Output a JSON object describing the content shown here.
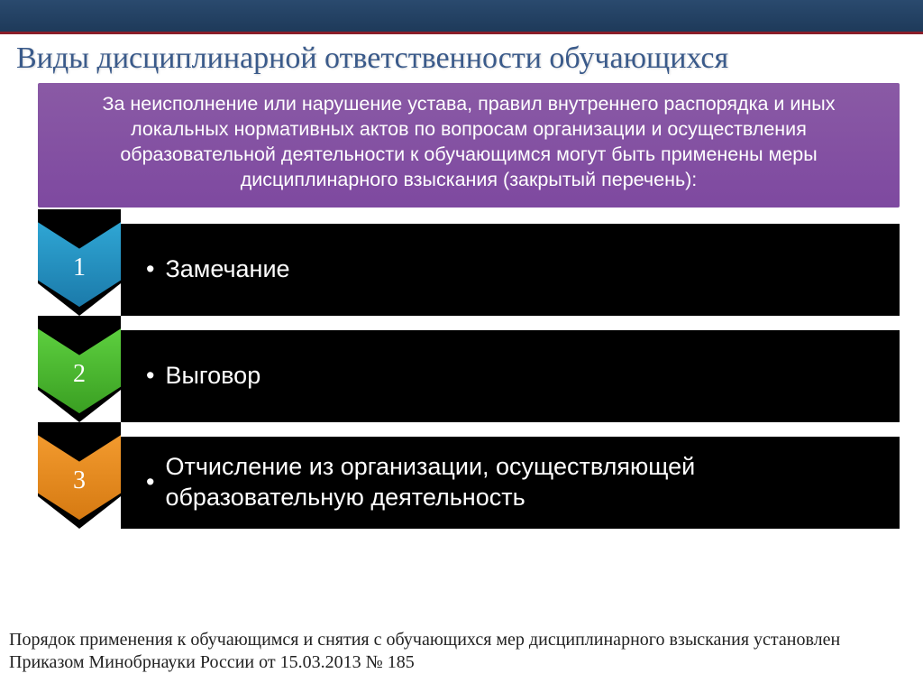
{
  "title": "Виды дисциплинарной ответственности обучающихся",
  "intro": "За неисполнение или нарушение устава, правил внутреннего распорядка и иных локальных нормативных актов по вопросам организации и осуществления образовательной деятельности к обучающимся могут быть применены меры дисциплинарного взыскания  (закрытый перечень):",
  "items": [
    {
      "num": "1",
      "text": "Замечание",
      "colorTop": "#2fa6d4",
      "colorBot": "#1b7aaa"
    },
    {
      "num": "2",
      "text": "Выговор",
      "colorTop": "#5dcf3f",
      "colorBot": "#3a9f22"
    },
    {
      "num": "3",
      "text": "Отчисление из организации, осуществляющей образовательную деятельность",
      "colorTop": "#f29a2e",
      "colorBot": "#d67a12"
    }
  ],
  "footer": "Порядок применения к обучающимся и снятия с обучающихся мер дисциплинарного взыскания установлен Приказом Минобрнауки России от 15.03.2013 № 185"
}
